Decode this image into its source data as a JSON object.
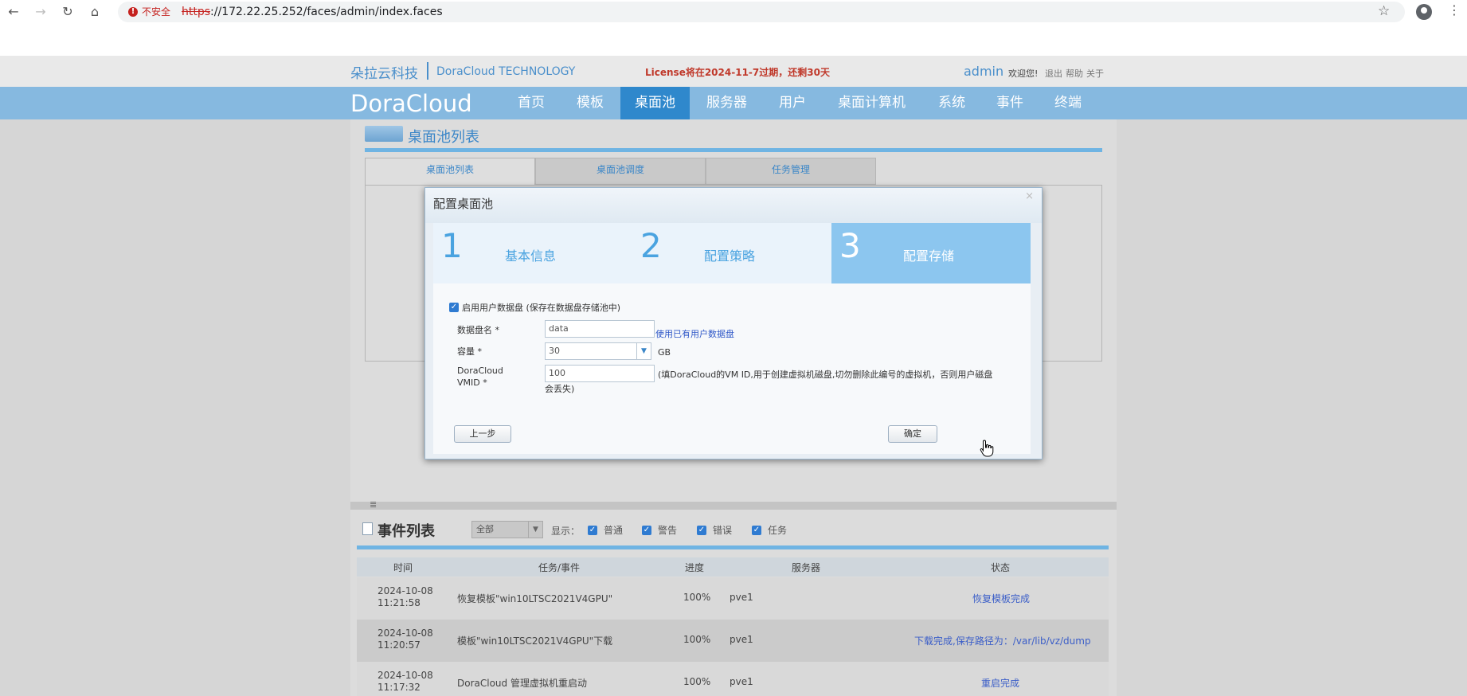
{
  "browser": {
    "insecure_label": "不安全",
    "url_proto": "https",
    "url_rest": "://172.22.25.252/faces/admin/index.faces"
  },
  "header": {
    "brand_cn": "朵拉云科技",
    "brand_en": "DoraCloud TECHNOLOGY",
    "license": "License将在2024-11-7过期，还剩30天",
    "user": "admin",
    "welcome": "欢迎您!",
    "links": [
      "退出",
      "帮助",
      "关于"
    ]
  },
  "nav": {
    "logo": "DoraCloud",
    "items": [
      "首页",
      "模板",
      "桌面池",
      "服务器",
      "用户",
      "桌面计算机",
      "系统",
      "事件",
      "终端"
    ],
    "active": "桌面池"
  },
  "content": {
    "title": "桌面池列表",
    "tabs": [
      "桌面池列表",
      "桌面池调度",
      "任务管理"
    ]
  },
  "modal": {
    "title": "配置桌面池",
    "close": "×",
    "steps": [
      {
        "num": "1",
        "label": "基本信息"
      },
      {
        "num": "2",
        "label": "配置策略"
      },
      {
        "num": "3",
        "label": "配置存储"
      }
    ],
    "active_step": 3,
    "enable_checkbox_label": "启用用户数据盘 (保存在数据盘存储池中)",
    "disk_name_label": "数据盘名 *",
    "disk_name_value": "data",
    "use_existing_link": "使用已有用户数据盘",
    "capacity_label": "容量 *",
    "capacity_value": "30",
    "capacity_unit": "GB",
    "vmid_label_1": "DoraCloud",
    "vmid_label_2": "VMID *",
    "vmid_value": "100",
    "vmid_note_1": "(填DoraCloud的VM ID,用于创建虚拟机磁盘,切勿删除此编号的虚拟机，否则用户磁盘",
    "vmid_note_2": "会丢失)",
    "prev_button": "上一步",
    "ok_button": "确定"
  },
  "events": {
    "title": "事件列表",
    "filter_value": "全部",
    "show_label": "显示：",
    "filters": [
      "普通",
      "警告",
      "错误",
      "任务"
    ],
    "columns": [
      "时间",
      "任务/事件",
      "进度",
      "服务器",
      "状态"
    ],
    "rows": [
      {
        "date": "2024-10-08",
        "time": "11:21:58",
        "task": "恢复模板\"win10LTSC2021V4GPU\"",
        "progress": "100%",
        "server": "pve1",
        "status": "恢复模板完成"
      },
      {
        "date": "2024-10-08",
        "time": "11:20:57",
        "task": "模板\"win10LTSC2021V4GPU\"下载",
        "progress": "100%",
        "server": "pve1",
        "status": "下载完成,保存路径为：/var/lib/vz/dump"
      },
      {
        "date": "2024-10-08",
        "time": "11:17:32",
        "task": "DoraCloud 管理虚拟机重启动",
        "progress": "100%",
        "server": "pve1",
        "status": "重启完成"
      }
    ]
  }
}
